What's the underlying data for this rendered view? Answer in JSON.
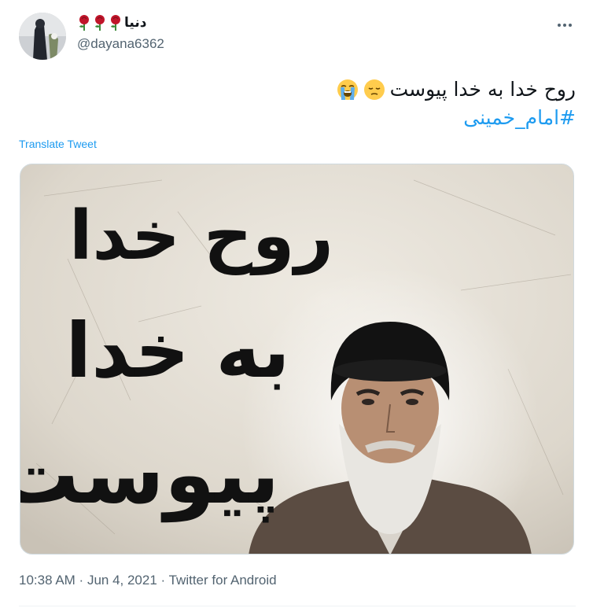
{
  "user": {
    "display_name": "دنیا",
    "handle": "@dayana6362",
    "avatar_icon": "profile-photo"
  },
  "tweet": {
    "text": "روح خدا به خدا پیوست",
    "emojis": [
      "pensive-face",
      "loudly-crying-face"
    ],
    "hashtag": "#امام_خمینی"
  },
  "translate_label": "Translate Tweet",
  "media": {
    "calligraphy": [
      "روح خدا",
      "به خدا",
      "پیوست"
    ]
  },
  "meta": {
    "time": "10:38 AM",
    "separator": " · ",
    "date": "Jun 4, 2021",
    "source": "Twitter for Android"
  },
  "colors": {
    "link": "#1d9bf0",
    "secondary_text": "#536471",
    "rose": "#c0152a"
  }
}
